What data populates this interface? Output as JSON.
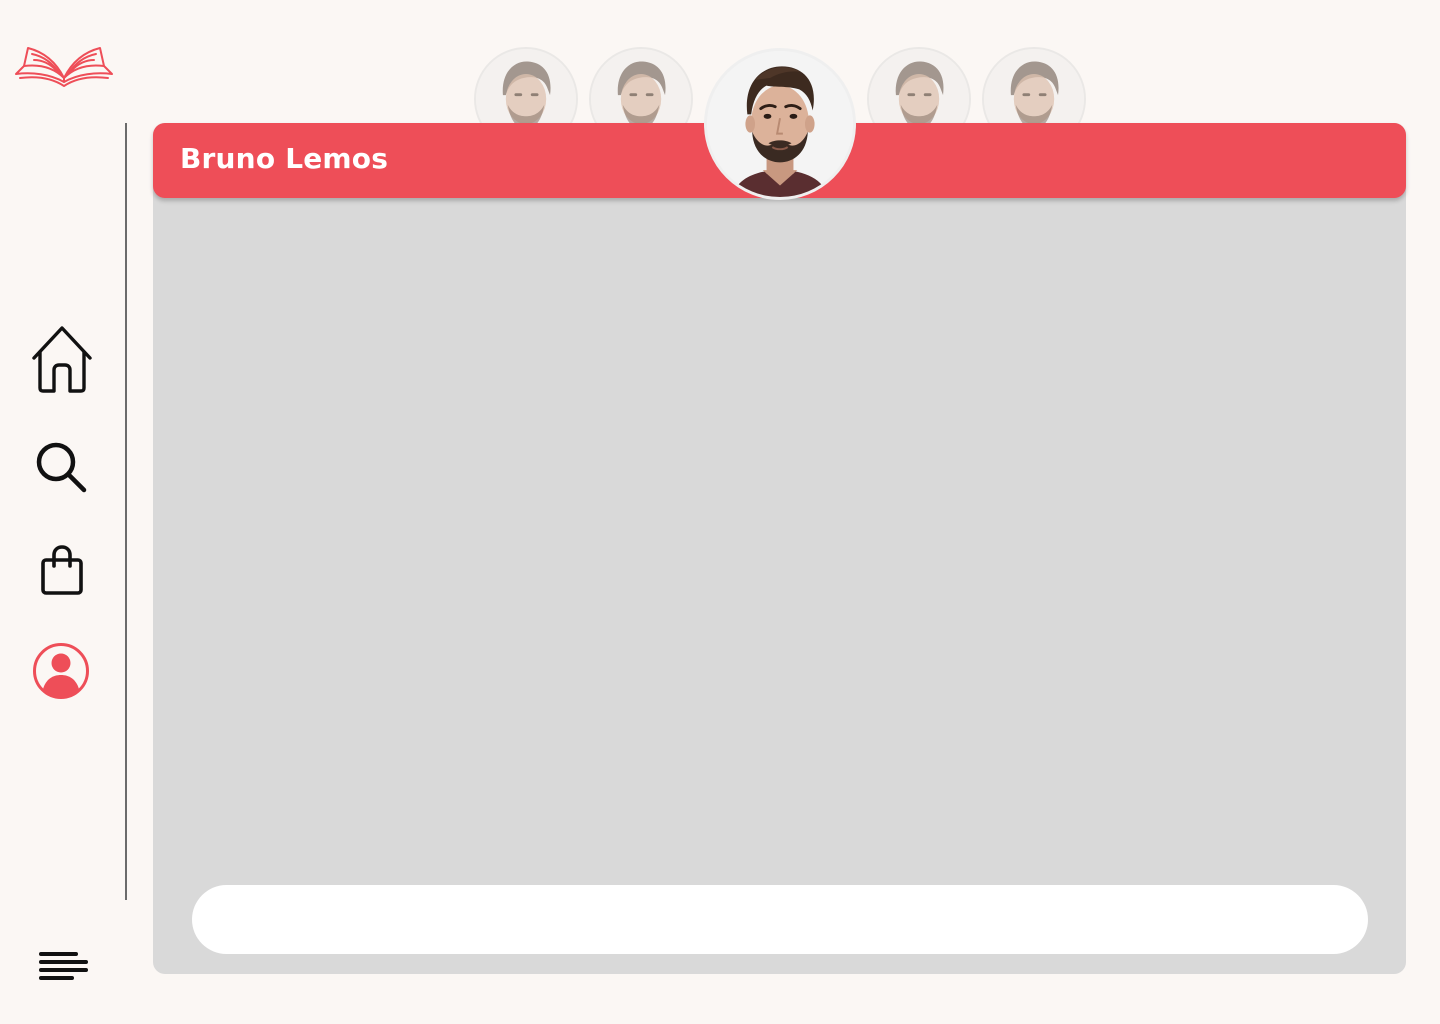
{
  "app": {
    "logo_icon": "open-book-icon",
    "accent_color": "#ee4e58"
  },
  "sidebar": {
    "items": [
      {
        "icon": "home-icon",
        "active": false
      },
      {
        "icon": "search-icon",
        "active": false
      },
      {
        "icon": "shopping-bag-icon",
        "active": false
      },
      {
        "icon": "user-profile-icon",
        "active": true
      },
      {
        "icon": "menu-icon",
        "active": false
      }
    ]
  },
  "chat": {
    "contact_name": "Bruno Lemos",
    "header_color": "#ee4e58",
    "message_input": {
      "value": "",
      "placeholder": ""
    }
  },
  "contacts": {
    "active_index": 2,
    "count": 5
  }
}
